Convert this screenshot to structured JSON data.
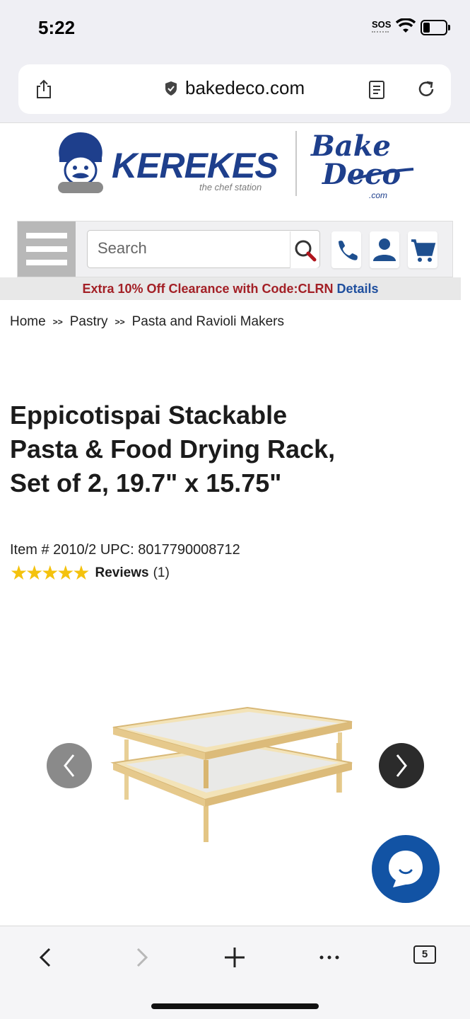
{
  "status_bar": {
    "time": "5:22",
    "sos": "SOS"
  },
  "browser": {
    "url_host": "bakedeco.com",
    "tabs_count": "5"
  },
  "header": {
    "kerekes_name": "KEREKES",
    "kerekes_tagline": "the chef station",
    "bakedeco_line1": "Bake",
    "bakedeco_line2": "Deco",
    "bakedeco_suffix": ".com"
  },
  "nav": {
    "search_placeholder": "Search"
  },
  "promo": {
    "text": "Extra 10% Off Clearance with Code:CLRN ",
    "link": "Details",
    "text_color": "#a32026",
    "link_color": "#1f4f9e"
  },
  "breadcrumb": {
    "items": [
      "Home",
      "Pastry",
      "Pasta and Ravioli Makers"
    ],
    "separator": ">>"
  },
  "product": {
    "title": "Eppicotispai Stackable Pasta & Food Drying Rack, Set of 2, 19.7\" x 15.75\"",
    "item_line": "Item # 2010/2  UPC: 8017790008712",
    "rating_stars": 5,
    "stars_glyph": "★★★★★",
    "reviews_label": "Reviews",
    "reviews_count": "(1)"
  },
  "colors": {
    "brand_blue": "#1e3f8c",
    "chat_blue": "#1253a4",
    "star_gold": "#f4c20d"
  }
}
